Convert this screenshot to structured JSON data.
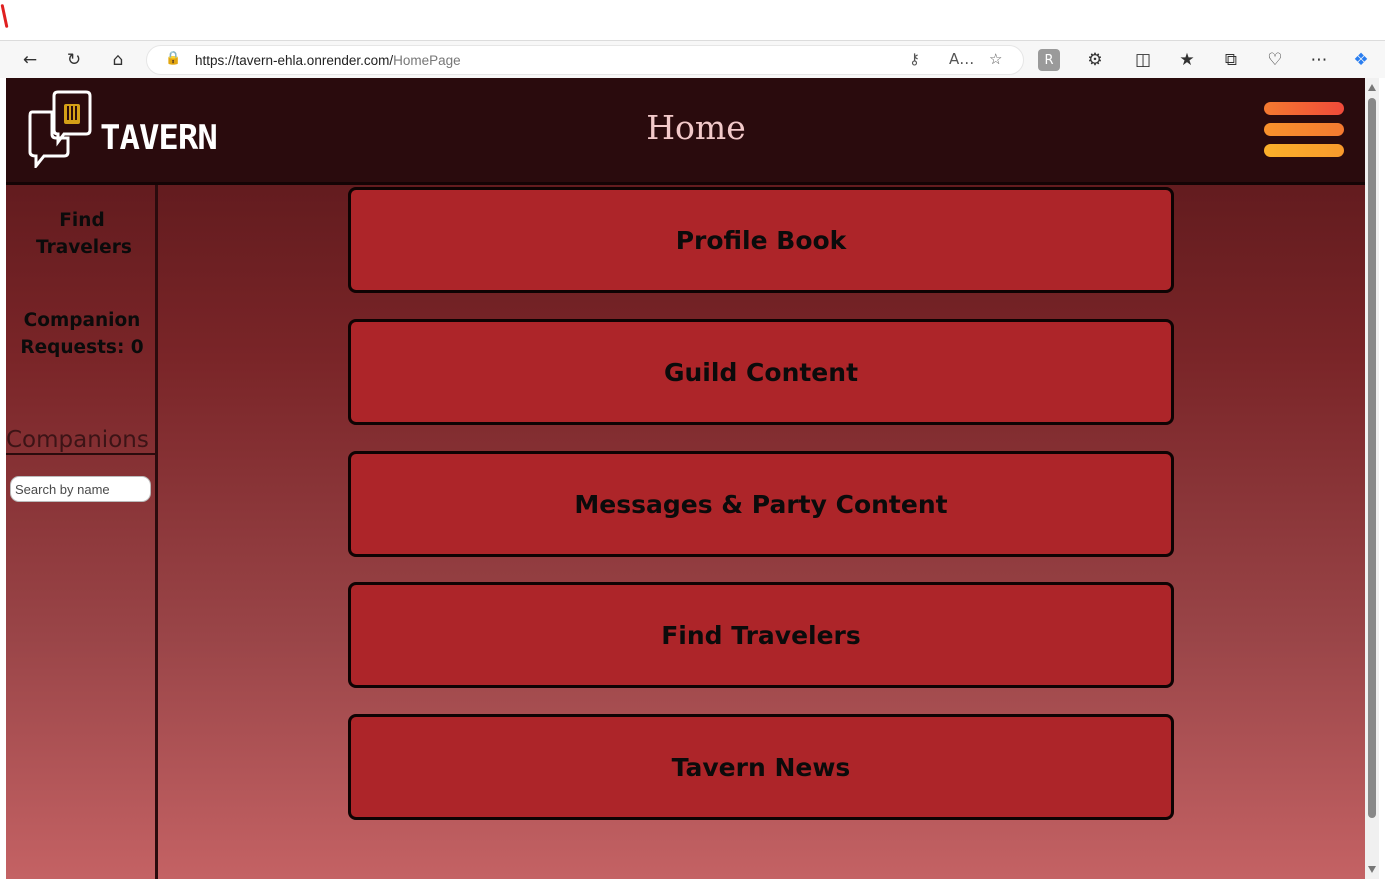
{
  "browser": {
    "url_host": "https://tavern-ehla.onrender.com/",
    "url_path": "HomePage"
  },
  "app": {
    "logo_text": "TAVERN",
    "page_title": "Home"
  },
  "sidebar": {
    "find_travelers": "Find Travelers",
    "companion_requests": "Companion Requests: 0",
    "companions_title": "Companions",
    "search_placeholder": "Search by name"
  },
  "menu": {
    "items": [
      {
        "label": "Profile Book"
      },
      {
        "label": "Guild Content"
      },
      {
        "label": "Messages & Party Content"
      },
      {
        "label": "Find Travelers"
      },
      {
        "label": "Tavern News"
      }
    ]
  },
  "colors": {
    "header_bg": "#2a0b0d",
    "button_bg": "#ad2529",
    "hamburger_top": "#f04a3a",
    "hamburger_mid": "#f47a30",
    "hamburger_bot": "#f8a92c"
  }
}
